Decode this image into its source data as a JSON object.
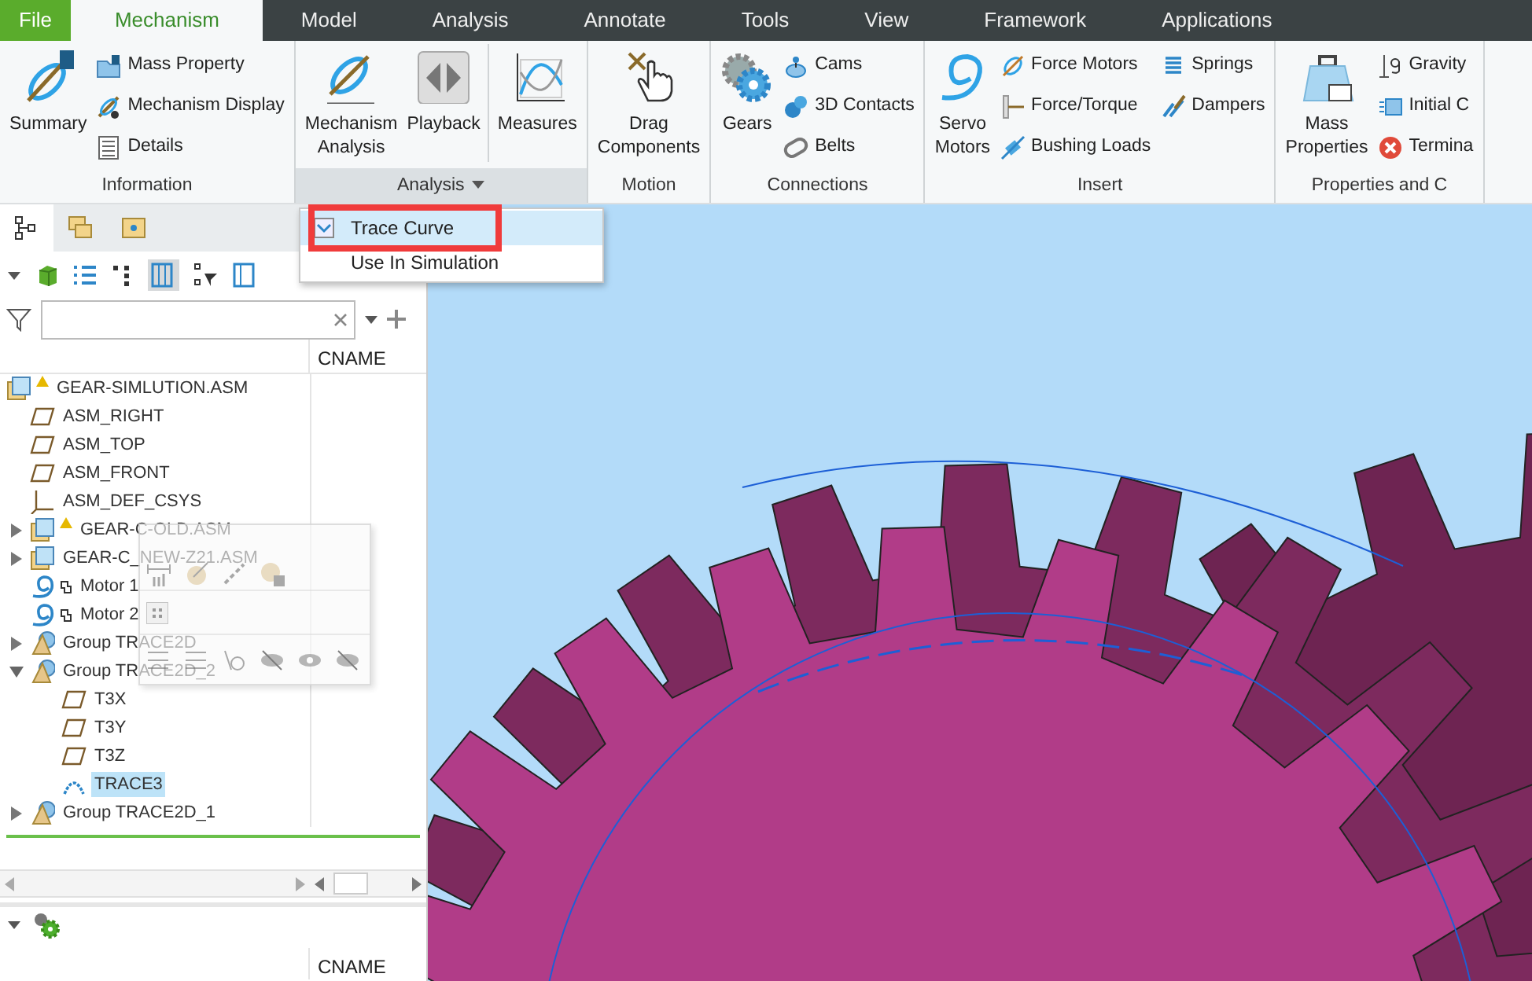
{
  "menu_tabs": [
    {
      "label": "File",
      "kind": "file",
      "selected": false
    },
    {
      "label": "Mechanism",
      "kind": "tab",
      "selected": true
    },
    {
      "label": "Model",
      "kind": "tab",
      "selected": false
    },
    {
      "label": "Analysis",
      "kind": "tab",
      "selected": false
    },
    {
      "label": "Annotate",
      "kind": "tab",
      "selected": false
    },
    {
      "label": "Tools",
      "kind": "tab",
      "selected": false
    },
    {
      "label": "View",
      "kind": "tab",
      "selected": false
    },
    {
      "label": "Framework",
      "kind": "tab",
      "selected": false
    },
    {
      "label": "Applications",
      "kind": "tab",
      "selected": false
    }
  ],
  "ribbon_groups": [
    {
      "label": "Information",
      "open": false,
      "sections": [
        {
          "kind": "large",
          "items": [
            {
              "label": "Summary"
            }
          ]
        },
        {
          "kind": "column",
          "items": [
            {
              "label": "Mass Property"
            },
            {
              "label": "Mechanism Display"
            },
            {
              "label": "Details"
            }
          ]
        }
      ]
    },
    {
      "label": "Analysis",
      "open": true,
      "has_dropdown": true,
      "sections": [
        {
          "kind": "large",
          "items": [
            {
              "label": "Mechanism\nAnalysis"
            }
          ]
        },
        {
          "kind": "large",
          "items": [
            {
              "label": "Playback"
            }
          ]
        },
        {
          "kind": "separator"
        },
        {
          "kind": "large",
          "items": [
            {
              "label": "Measures"
            }
          ]
        }
      ]
    },
    {
      "label": "Motion",
      "open": false,
      "sections": [
        {
          "kind": "large",
          "items": [
            {
              "label": "Drag\nComponents"
            }
          ]
        }
      ]
    },
    {
      "label": "Connections",
      "open": false,
      "sections": [
        {
          "kind": "large",
          "items": [
            {
              "label": "Gears"
            }
          ]
        },
        {
          "kind": "column",
          "items": [
            {
              "label": "Cams"
            },
            {
              "label": "3D Contacts"
            },
            {
              "label": "Belts"
            }
          ]
        }
      ]
    },
    {
      "label": "Insert",
      "open": false,
      "sections": [
        {
          "kind": "large",
          "items": [
            {
              "label": "Servo\nMotors"
            }
          ]
        },
        {
          "kind": "column",
          "items": [
            {
              "label": "Force Motors"
            },
            {
              "label": "Force/Torque"
            },
            {
              "label": "Bushing Loads"
            }
          ]
        },
        {
          "kind": "column",
          "items": [
            {
              "label": "Springs"
            },
            {
              "label": "Dampers"
            }
          ]
        }
      ]
    },
    {
      "label": "Properties and C",
      "open": false,
      "sections": [
        {
          "kind": "large",
          "items": [
            {
              "label": "Mass\nProperties"
            }
          ]
        },
        {
          "kind": "column",
          "items": [
            {
              "label": "Gravity"
            },
            {
              "label": "Initial C"
            },
            {
              "label": "Termina"
            }
          ]
        }
      ]
    }
  ],
  "analysis_menu": [
    {
      "label": "Trace Curve",
      "selected": true,
      "framed": true
    },
    {
      "label": "Use In Simulation",
      "selected": false,
      "framed": false
    }
  ],
  "panel_tabs": [
    {
      "selected": true
    },
    {
      "selected": false
    },
    {
      "selected": false
    }
  ],
  "tree": {
    "column": "CNAME",
    "items": [
      {
        "label": "GEAR-SIMLUTION.ASM",
        "kind": "assembly",
        "warning": true,
        "selected": false,
        "children": [
          {
            "label": "ASM_RIGHT",
            "kind": "plane",
            "selected": false
          },
          {
            "label": "ASM_TOP",
            "kind": "plane",
            "selected": false
          },
          {
            "label": "ASM_FRONT",
            "kind": "plane",
            "selected": false
          },
          {
            "label": "ASM_DEF_CSYS",
            "kind": "csys",
            "selected": false
          },
          {
            "label": "GEAR-C-OLD.ASM",
            "kind": "assembly",
            "warning": true,
            "expanded": false,
            "selected": false
          },
          {
            "label": "GEAR-C_NEW-Z21.ASM",
            "kind": "assembly",
            "expanded": false,
            "selected": false
          },
          {
            "label": "Motor 1",
            "kind": "motor",
            "selected": false
          },
          {
            "label": "Motor 2",
            "kind": "motor",
            "selected": false
          },
          {
            "label": "Group TRACE2D",
            "kind": "group",
            "expanded": false,
            "selected": false
          },
          {
            "label": "Group TRACE2D_2",
            "kind": "group",
            "expanded": true,
            "selected": false,
            "children": [
              {
                "label": "T3X",
                "kind": "plane",
                "selected": false
              },
              {
                "label": "T3Y",
                "kind": "plane",
                "selected": false
              },
              {
                "label": "T3Z",
                "kind": "plane",
                "selected": false
              },
              {
                "label": "TRACE3",
                "kind": "curve",
                "selected": true
              }
            ]
          },
          {
            "label": "Group TRACE2D_1",
            "kind": "group",
            "expanded": false,
            "selected": false
          }
        ]
      }
    ]
  },
  "lower_panel": {
    "column": "CNAME"
  }
}
